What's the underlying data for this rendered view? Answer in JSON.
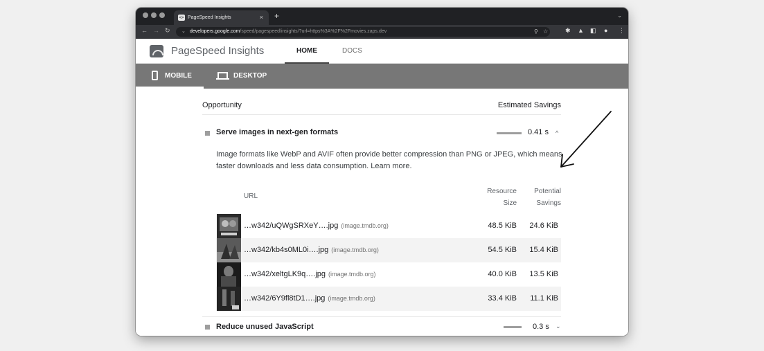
{
  "browser": {
    "tab_title": "PageSpeed Insights",
    "tab_close": "×",
    "new_tab": "+",
    "url_host": "developers.google.com",
    "url_path": "/speed/pagespeed/insights/?url=https%3A%2F%2Fmovies.zaps.dev"
  },
  "psi": {
    "title": "PageSpeed Insights",
    "nav": {
      "home": "HOME",
      "docs": "DOCS"
    },
    "device": {
      "mobile": "MOBILE",
      "desktop": "DESKTOP"
    }
  },
  "opportunities": {
    "header_left": "Opportunity",
    "header_right": "Estimated Savings",
    "audits": [
      {
        "title": "Serve images in next-gen formats",
        "value": "0.41 s",
        "chevron": "^",
        "description": "Image formats like WebP and AVIF often provide better compression than PNG or JPEG, which means faster downloads and less data consumption.",
        "learn_more": "Learn more."
      },
      {
        "title": "Reduce unused JavaScript",
        "value": "0.3 s",
        "chevron": "⌄"
      }
    ],
    "table": {
      "col_url": "URL",
      "col_resource": "Resource",
      "col_resource_2": "Size",
      "col_potential": "Potential",
      "col_potential_2": "Savings",
      "rows": [
        {
          "url": "…w342/uQWgSRXeY….jpg",
          "host": "(image.tmdb.org)",
          "size": "48.5 KiB",
          "savings": "24.6 KiB"
        },
        {
          "url": "…w342/kb4s0ML0i….jpg",
          "host": "(image.tmdb.org)",
          "size": "54.5 KiB",
          "savings": "15.4 KiB"
        },
        {
          "url": "…w342/xeltgLK9q….jpg",
          "host": "(image.tmdb.org)",
          "size": "40.0 KiB",
          "savings": "13.5 KiB"
        },
        {
          "url": "…w342/6Y9fl8tD1….jpg",
          "host": "(image.tmdb.org)",
          "size": "33.4 KiB",
          "savings": "11.1 KiB"
        }
      ]
    }
  }
}
